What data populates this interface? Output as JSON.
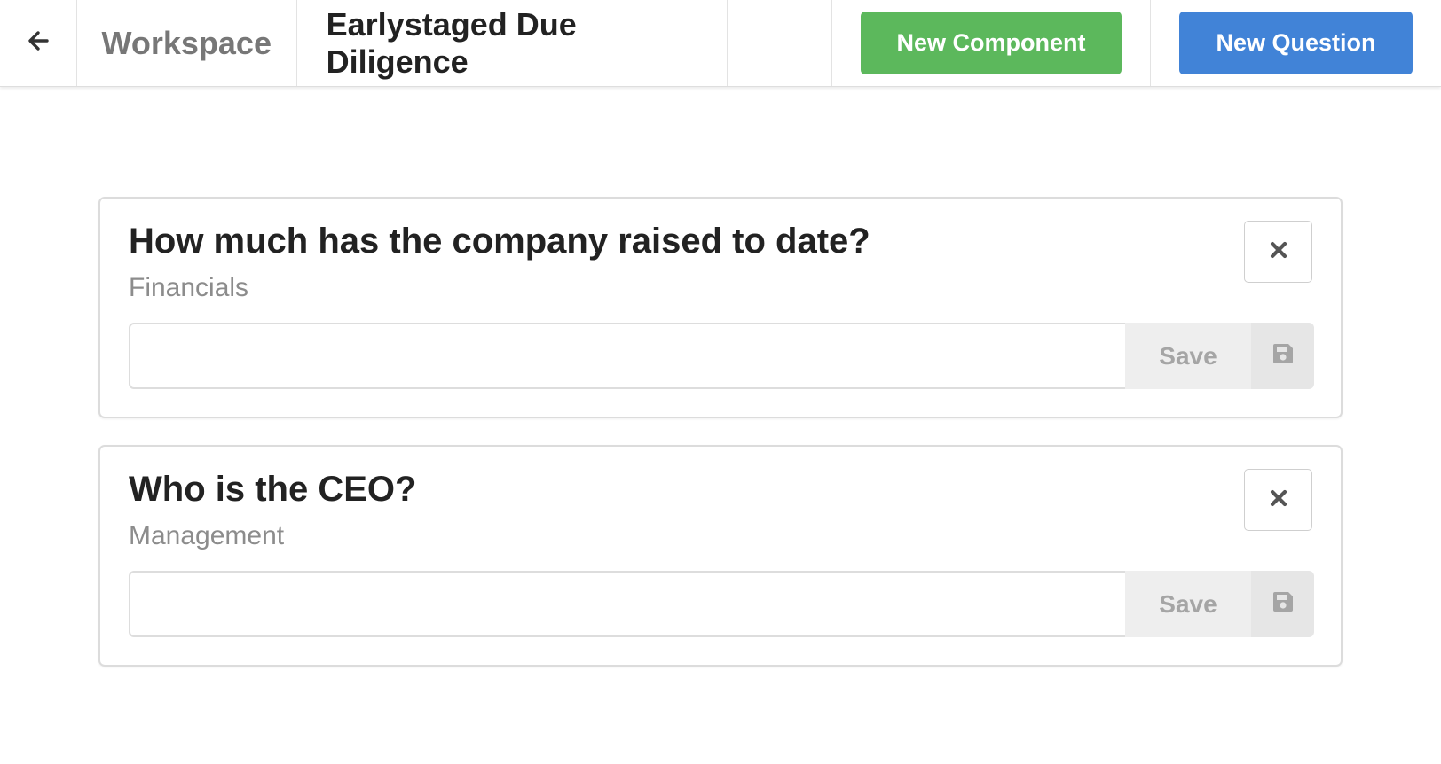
{
  "topbar": {
    "back_icon": "arrow-left-icon",
    "workspace_label": "Workspace",
    "title": "Earlystaged Due Diligence",
    "new_component_label": "New Component",
    "new_question_label": "New Question"
  },
  "colors": {
    "green_button": "#5cb85c",
    "blue_button": "#4183d7",
    "save_text": "#a5a5a5",
    "category_text": "#8c8c8c"
  },
  "questions": [
    {
      "title": "How much has the company raised to date?",
      "category": "Financials",
      "answer_value": "",
      "save_label": "Save",
      "close_icon": "close-icon",
      "save_icon": "floppy-disk-icon"
    },
    {
      "title": "Who is the CEO?",
      "category": "Management",
      "answer_value": "",
      "save_label": "Save",
      "close_icon": "close-icon",
      "save_icon": "floppy-disk-icon"
    }
  ]
}
